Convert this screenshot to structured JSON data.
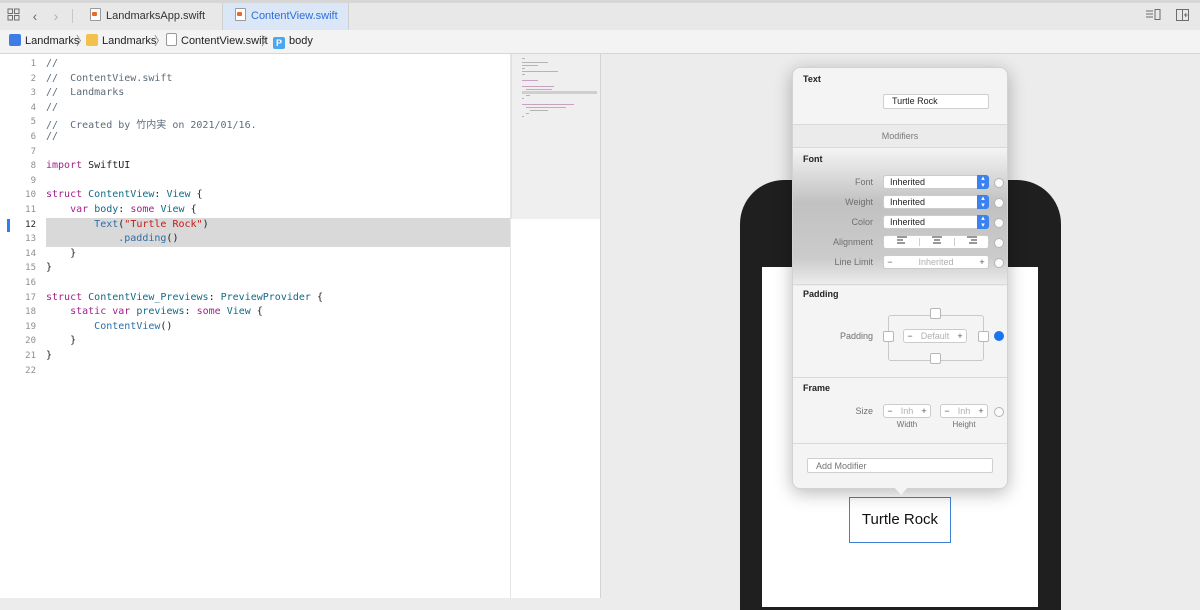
{
  "tabs": [
    {
      "label": "LandmarksApp.swift",
      "active": false
    },
    {
      "label": "ContentView.swift",
      "active": true
    }
  ],
  "breadcrumb": {
    "project": "Landmarks",
    "folder": "Landmarks",
    "file": "ContentView.swift",
    "symbol": "body",
    "symbol_badge": "P"
  },
  "editor": {
    "current_line": 12,
    "lines": [
      {
        "n": "1",
        "segs": [
          {
            "t": "//",
            "c": "cm"
          }
        ]
      },
      {
        "n": "2",
        "segs": [
          {
            "t": "//  ContentView.swift",
            "c": "cm"
          }
        ]
      },
      {
        "n": "3",
        "segs": [
          {
            "t": "//  Landmarks",
            "c": "cm"
          }
        ]
      },
      {
        "n": "4",
        "segs": [
          {
            "t": "//",
            "c": "cm"
          }
        ]
      },
      {
        "n": "5",
        "segs": [
          {
            "t": "//  Created by 竹内実 on 2021/01/16.",
            "c": "cm"
          }
        ]
      },
      {
        "n": "6",
        "segs": [
          {
            "t": "//",
            "c": "cm"
          }
        ]
      },
      {
        "n": "7",
        "segs": []
      },
      {
        "n": "8",
        "segs": [
          {
            "t": "import",
            "c": "kw"
          },
          {
            "t": " SwiftUI",
            "c": ""
          }
        ]
      },
      {
        "n": "9",
        "segs": []
      },
      {
        "n": "10",
        "segs": [
          {
            "t": "struct",
            "c": "kw"
          },
          {
            "t": " ",
            "c": ""
          },
          {
            "t": "ContentView",
            "c": "ty"
          },
          {
            "t": ": ",
            "c": ""
          },
          {
            "t": "View",
            "c": "ty"
          },
          {
            "t": " {",
            "c": ""
          }
        ]
      },
      {
        "n": "11",
        "segs": [
          {
            "t": "    ",
            "c": ""
          },
          {
            "t": "var",
            "c": "kw"
          },
          {
            "t": " ",
            "c": ""
          },
          {
            "t": "body",
            "c": "ty"
          },
          {
            "t": ": ",
            "c": ""
          },
          {
            "t": "some",
            "c": "kw"
          },
          {
            "t": " ",
            "c": ""
          },
          {
            "t": "View",
            "c": "ty"
          },
          {
            "t": " {",
            "c": ""
          }
        ]
      },
      {
        "n": "12",
        "segs": [
          {
            "t": "        ",
            "c": ""
          },
          {
            "t": "Text",
            "c": "fn"
          },
          {
            "t": "(",
            "c": ""
          },
          {
            "t": "\"Turtle Rock\"",
            "c": "str"
          },
          {
            "t": ")",
            "c": ""
          }
        ]
      },
      {
        "n": "13",
        "segs": [
          {
            "t": "            ",
            "c": ""
          },
          {
            "t": ".padding",
            "c": "fn"
          },
          {
            "t": "()",
            "c": ""
          }
        ]
      },
      {
        "n": "14",
        "segs": [
          {
            "t": "    }",
            "c": ""
          }
        ]
      },
      {
        "n": "15",
        "segs": [
          {
            "t": "}",
            "c": ""
          }
        ]
      },
      {
        "n": "16",
        "segs": []
      },
      {
        "n": "17",
        "segs": [
          {
            "t": "struct",
            "c": "kw"
          },
          {
            "t": " ",
            "c": ""
          },
          {
            "t": "ContentView_Previews",
            "c": "ty"
          },
          {
            "t": ": ",
            "c": ""
          },
          {
            "t": "PreviewProvider",
            "c": "ty"
          },
          {
            "t": " {",
            "c": ""
          }
        ]
      },
      {
        "n": "18",
        "segs": [
          {
            "t": "    ",
            "c": ""
          },
          {
            "t": "static",
            "c": "kw"
          },
          {
            "t": " ",
            "c": ""
          },
          {
            "t": "var",
            "c": "kw"
          },
          {
            "t": " ",
            "c": ""
          },
          {
            "t": "previews",
            "c": "ty"
          },
          {
            "t": ": ",
            "c": ""
          },
          {
            "t": "some",
            "c": "kw"
          },
          {
            "t": " ",
            "c": ""
          },
          {
            "t": "View",
            "c": "ty"
          },
          {
            "t": " {",
            "c": ""
          }
        ]
      },
      {
        "n": "19",
        "segs": [
          {
            "t": "        ",
            "c": ""
          },
          {
            "t": "ContentView",
            "c": "fn"
          },
          {
            "t": "()",
            "c": ""
          }
        ]
      },
      {
        "n": "20",
        "segs": [
          {
            "t": "    }",
            "c": ""
          }
        ]
      },
      {
        "n": "21",
        "segs": [
          {
            "t": "}",
            "c": ""
          }
        ]
      },
      {
        "n": "22",
        "segs": []
      }
    ]
  },
  "inspector": {
    "text_section": {
      "title": "Text",
      "value": "Turtle Rock"
    },
    "modifiers_header": "Modifiers",
    "font_section": {
      "title": "Font",
      "font_label": "Font",
      "font_value": "Inherited",
      "weight_label": "Weight",
      "weight_value": "Inherited",
      "color_label": "Color",
      "color_value": "Inherited",
      "alignment_label": "Alignment",
      "line_limit_label": "Line Limit",
      "line_limit_value": "Inherited"
    },
    "padding_section": {
      "title": "Padding",
      "label": "Padding",
      "value": "Default"
    },
    "frame_section": {
      "title": "Frame",
      "size_label": "Size",
      "width_value": "Inh",
      "height_value": "Inh",
      "width_caption": "Width",
      "height_caption": "Height"
    },
    "add_modifier_placeholder": "Add Modifier"
  },
  "preview": {
    "text": "Turtle Rock"
  },
  "colors": {
    "accent": "#1a74f0",
    "keyword": "#a3208c",
    "type": "#0f6a86",
    "string": "#c41a16",
    "comment": "#5d6c79"
  }
}
